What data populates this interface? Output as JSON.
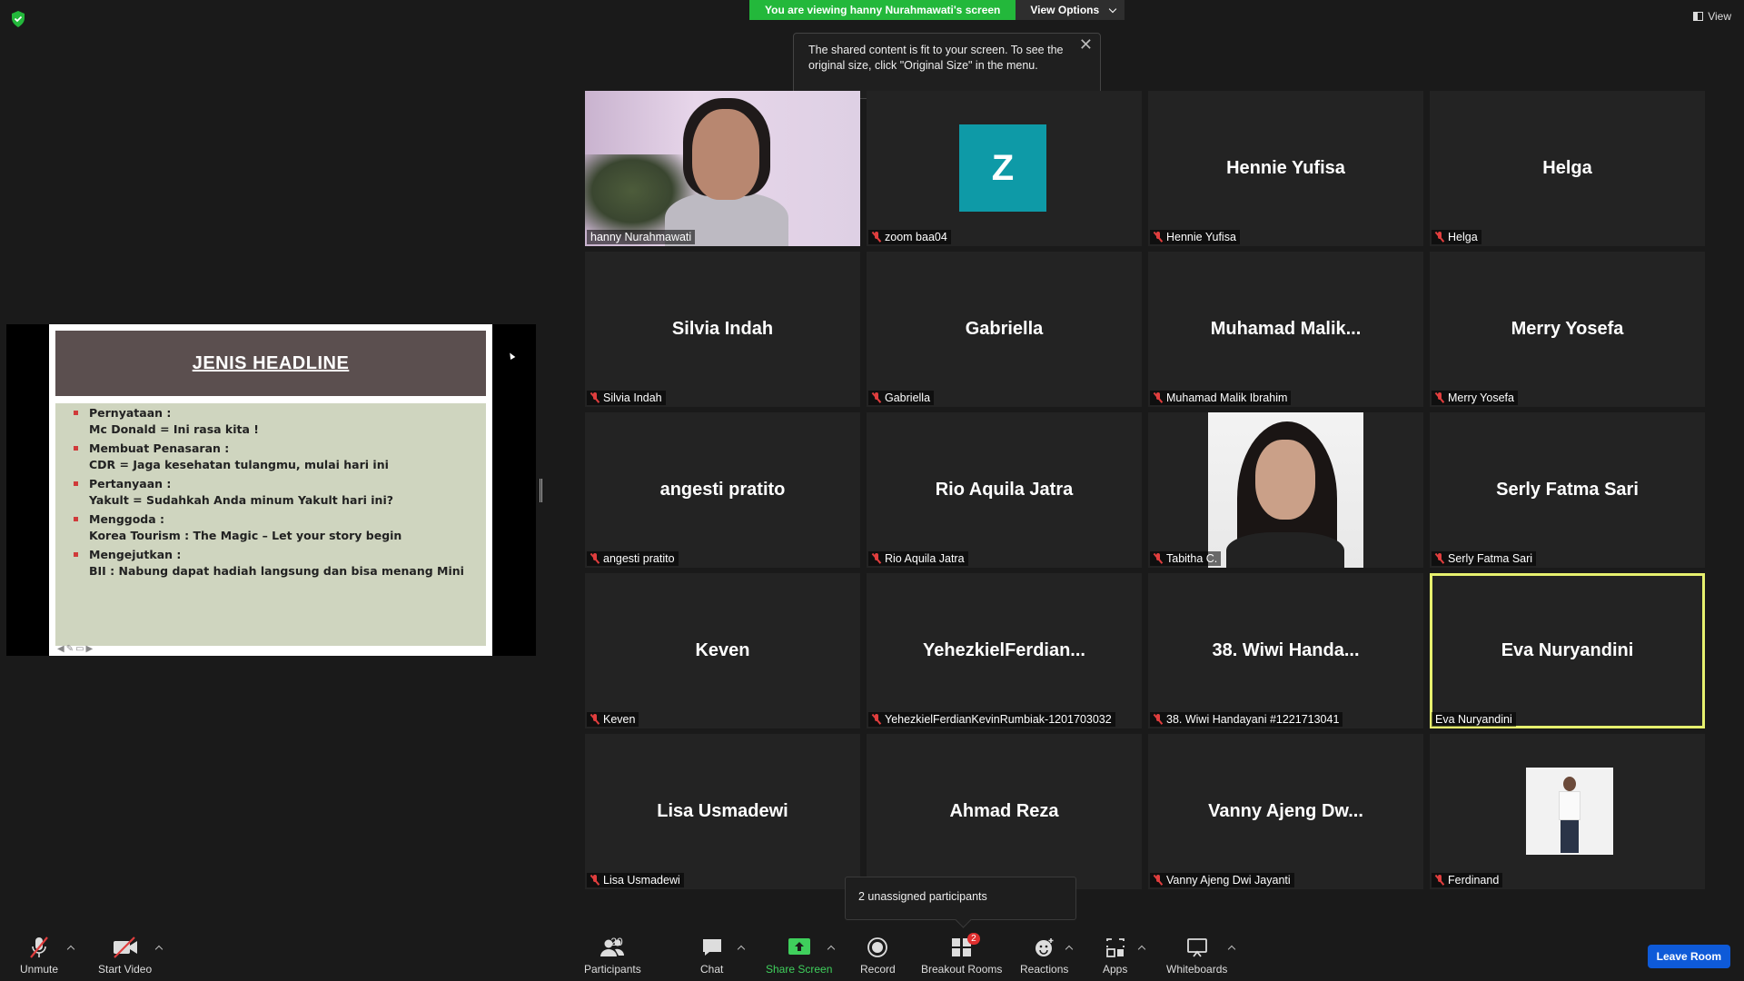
{
  "banner": {
    "viewing_text": "You are viewing hanny Nurahmawati's screen",
    "view_options_label": "View Options",
    "view_label": "View"
  },
  "tooltip": {
    "text": "The shared content is fit to your screen. To see the original size, click \"Original Size\" in the menu."
  },
  "slide": {
    "headline": "JENIS HEADLINE",
    "items": [
      {
        "title": "Pernyataan :",
        "detail": "Mc Donald = Ini rasa kita !"
      },
      {
        "title": "Membuat Penasaran :",
        "detail": "CDR = Jaga kesehatan tulangmu, mulai hari ini"
      },
      {
        "title": "Pertanyaan :",
        "detail": "Yakult = Sudahkah Anda minum Yakult hari ini?"
      },
      {
        "title": "Menggoda :",
        "detail": "Korea Tourism : The Magic – Let your story begin"
      },
      {
        "title": "Mengejutkan :",
        "detail": "BII : Nabung dapat hadiah langsung dan bisa menang Mini"
      }
    ]
  },
  "participants": [
    {
      "display": "",
      "label": "hanny Nurahmawati",
      "muted": false,
      "kind": "photo-hanny"
    },
    {
      "display": "Z",
      "label": "zoom baa04",
      "muted": true,
      "kind": "avatar-z"
    },
    {
      "display": "Hennie Yufisa",
      "label": "Hennie Yufisa",
      "muted": true,
      "kind": "name"
    },
    {
      "display": "Helga",
      "label": "Helga",
      "muted": true,
      "kind": "name"
    },
    {
      "display": "Silvia Indah",
      "label": "Silvia Indah",
      "muted": true,
      "kind": "name"
    },
    {
      "display": "Gabriella",
      "label": "Gabriella",
      "muted": true,
      "kind": "name"
    },
    {
      "display": "Muhamad  Malik...",
      "label": "Muhamad Malik Ibrahim",
      "muted": true,
      "kind": "name"
    },
    {
      "display": "Merry Yosefa",
      "label": "Merry Yosefa",
      "muted": true,
      "kind": "name"
    },
    {
      "display": "angesti pratito",
      "label": "angesti pratito",
      "muted": true,
      "kind": "name"
    },
    {
      "display": "Rio Aquila Jatra",
      "label": "Rio Aquila Jatra",
      "muted": true,
      "kind": "name"
    },
    {
      "display": "",
      "label": "Tabitha C.",
      "muted": true,
      "kind": "photo-tabitha"
    },
    {
      "display": "Serly Fatma Sari",
      "label": "Serly Fatma Sari",
      "muted": true,
      "kind": "name"
    },
    {
      "display": "Keven",
      "label": "Keven",
      "muted": true,
      "kind": "name"
    },
    {
      "display": "YehezkielFerdian...",
      "label": "YehezkielFerdianKevinRumbiak-1201703032",
      "muted": true,
      "kind": "name"
    },
    {
      "display": "38. Wiwi Handa...",
      "label": "38. Wiwi Handayani #1221713041",
      "muted": true,
      "kind": "name"
    },
    {
      "display": "Eva Nuryandini",
      "label": "Eva Nuryandini",
      "muted": false,
      "kind": "name",
      "active": true
    },
    {
      "display": "Lisa Usmadewi",
      "label": "Lisa Usmadewi",
      "muted": true,
      "kind": "name"
    },
    {
      "display": "Ahmad Reza",
      "label": "",
      "muted": false,
      "kind": "name"
    },
    {
      "display": "Vanny Ajeng Dw...",
      "label": "Vanny Ajeng Dwi Jayanti",
      "muted": true,
      "kind": "name"
    },
    {
      "display": "",
      "label": "Ferdinand",
      "muted": true,
      "kind": "photo-ferdinand"
    }
  ],
  "unassigned": {
    "text": "2 unassigned participants"
  },
  "toolbar": {
    "unmute": "Unmute",
    "start_video": "Start Video",
    "participants": "Participants",
    "participants_count": "20",
    "chat": "Chat",
    "share_screen": "Share Screen",
    "record": "Record",
    "breakout_rooms": "Breakout Rooms",
    "breakout_badge": "2",
    "reactions": "Reactions",
    "apps": "Apps",
    "whiteboards": "Whiteboards",
    "leave_room": "Leave Room"
  },
  "colors": {
    "banner_green": "#23b83b",
    "active_speaker": "#e6f06e",
    "mute_red": "#e03e3e",
    "leave_blue": "#0e5ad8",
    "avatar_teal": "#0e9aa7"
  }
}
